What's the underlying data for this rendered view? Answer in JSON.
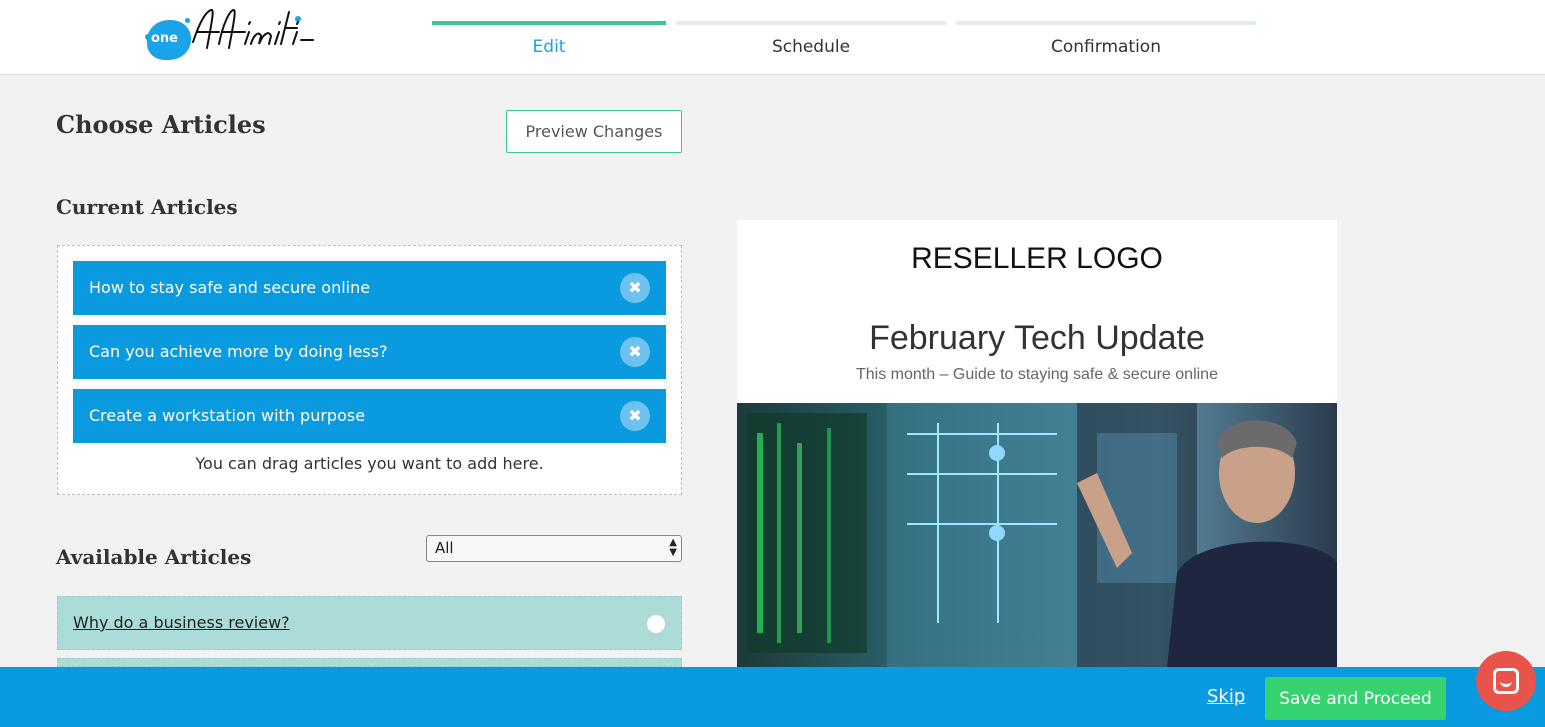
{
  "header": {
    "logo_text": "one affiniti",
    "logo_badge": "one",
    "steps": [
      {
        "label": "Edit",
        "active": true
      },
      {
        "label": "Schedule",
        "active": false
      },
      {
        "label": "Confirmation",
        "active": false
      }
    ]
  },
  "main": {
    "title": "Choose Articles",
    "preview_button": "Preview Changes",
    "current": {
      "heading": "Current Articles",
      "items": [
        {
          "title": "How to stay safe and secure online",
          "remove_icon": "close-icon"
        },
        {
          "title": "Can you achieve more by doing less?",
          "remove_icon": "close-icon"
        },
        {
          "title": "Create a workstation with purpose",
          "remove_icon": "close-icon"
        }
      ],
      "remove_glyph": "✖",
      "drag_hint": "You can drag articles you want to add here."
    },
    "available": {
      "heading": "Available Articles",
      "filter_value": "All",
      "items": [
        {
          "title": "Why do a business review?"
        }
      ]
    }
  },
  "preview": {
    "logo_text": "RESELLER LOGO",
    "title": "February Tech Update",
    "subtitle": "This month – Guide to staying safe & secure online"
  },
  "footer": {
    "skip_label": "Skip",
    "save_label": "Save and Proceed"
  },
  "colors": {
    "brand_blue": "#0a9ae0",
    "accent_green": "#3cc59a",
    "save_green": "#35d36f",
    "available_teal": "#acdcd8",
    "chat_red": "#e8544a"
  }
}
